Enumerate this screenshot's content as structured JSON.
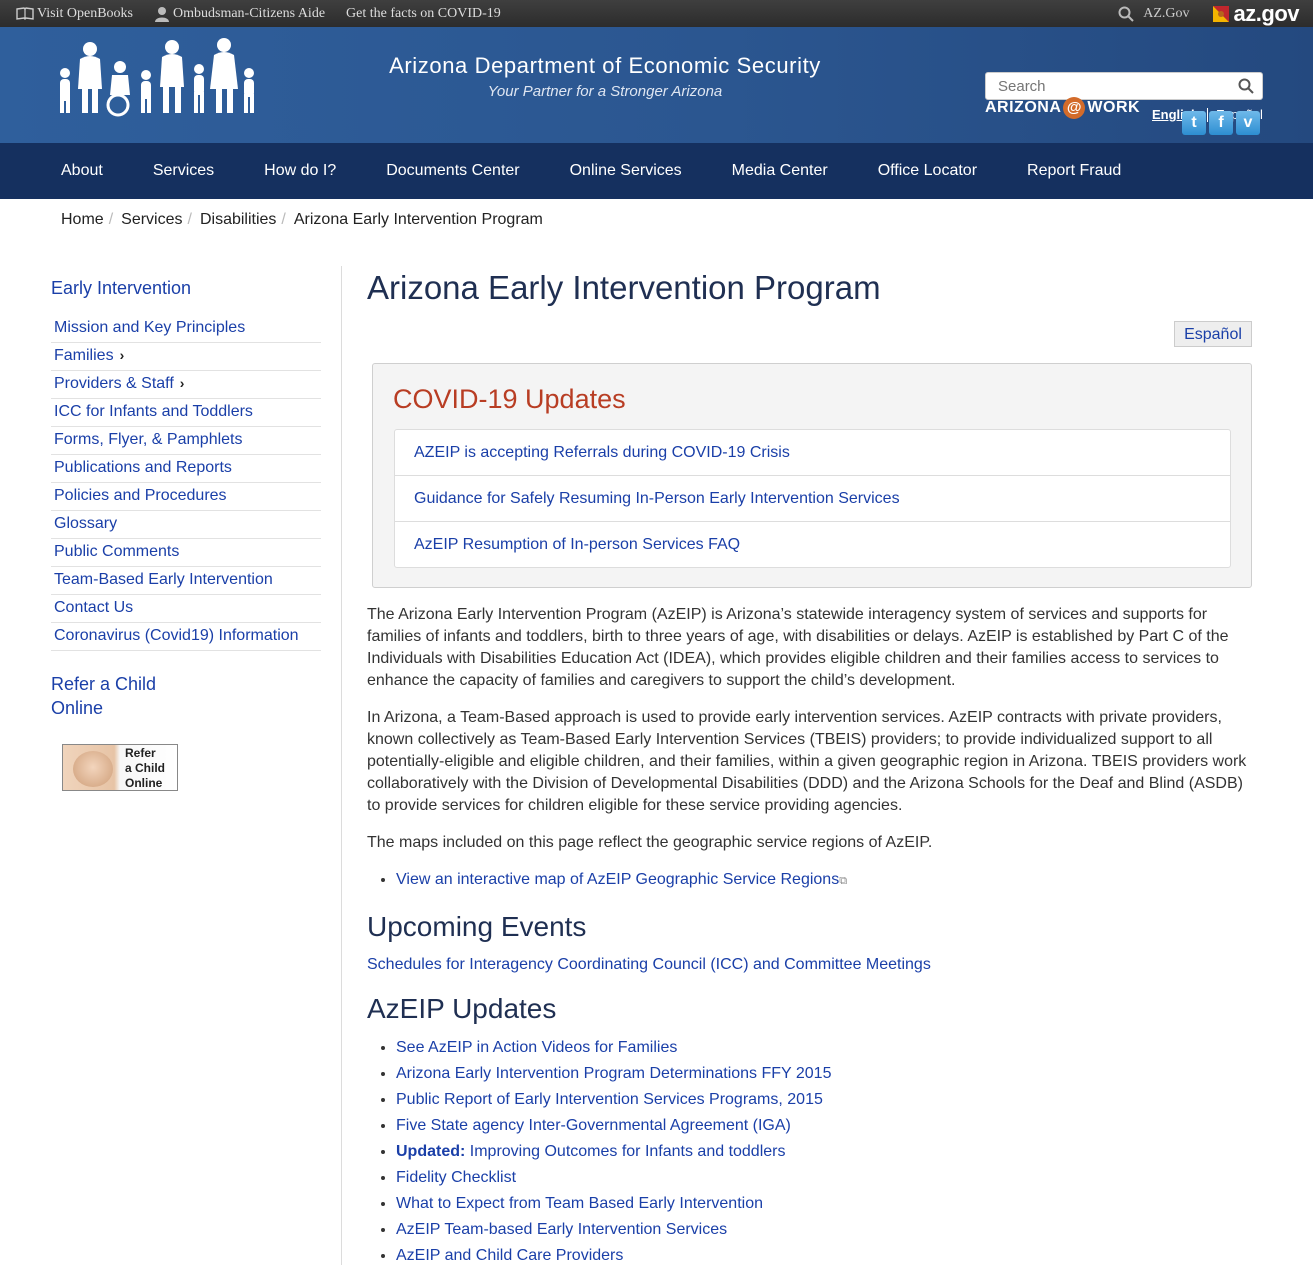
{
  "topbar": {
    "openbooks": "Visit OpenBooks",
    "ombudsman": "Ombudsman-Citizens Aide",
    "covid_facts": "Get the facts on COVID-19",
    "azgov_link": "AZ.Gov",
    "azgov_logo": "az.gov"
  },
  "header": {
    "agency_name": "Arizona Department of Economic Security",
    "tagline": "Your Partner for a Stronger Arizona",
    "search_placeholder": "Search",
    "lang_english": "English",
    "lang_espanol": "Español",
    "azwork_left": "ARIZONA",
    "azwork_at": "@",
    "azwork_right": "WORK",
    "social": [
      "t",
      "f",
      "v"
    ]
  },
  "nav": [
    "About",
    "Services",
    "How do I?",
    "Documents Center",
    "Online Services",
    "Media Center",
    "Office Locator",
    "Report Fraud"
  ],
  "breadcrumb": [
    "Home",
    "Services",
    "Disabilities",
    "Arizona Early Intervention Program"
  ],
  "sidebar": {
    "title": "Early Intervention",
    "items": [
      {
        "label": "Mission and Key Principles",
        "chev": ""
      },
      {
        "label": "Families",
        "chev": "›"
      },
      {
        "label": "Providers & Staff",
        "chev": "›"
      },
      {
        "label": "ICC for Infants and Toddlers",
        "chev": ""
      },
      {
        "label": "Forms, Flyer, & Pamphlets",
        "chev": ""
      },
      {
        "label": "Publications and Reports",
        "chev": ""
      },
      {
        "label": "Policies and Procedures",
        "chev": ""
      },
      {
        "label": "Glossary",
        "chev": ""
      },
      {
        "label": "Public Comments",
        "chev": ""
      },
      {
        "label": "Team-Based Early Intervention",
        "chev": ""
      },
      {
        "label": "Contact Us",
        "chev": ""
      },
      {
        "label": "Coronavirus (Covid19) Information",
        "chev": ""
      }
    ],
    "refer_line1": "Refer a Child",
    "refer_line2": "Online",
    "refer_img_text": [
      "Refer",
      "a Child",
      "Online"
    ]
  },
  "main": {
    "title": "Arizona Early Intervention Program",
    "espanol_button": "Español",
    "covid_title": "COVID-19 Updates",
    "covid_links": [
      "AZEIP is accepting Referrals during COVID-19 Crisis",
      "Guidance for Safely Resuming In-Person Early Intervention Services",
      "AzEIP Resumption of In-person Services FAQ"
    ],
    "para1": "The Arizona Early Intervention Program (AzEIP) is Arizona’s statewide interagency system of services and supports for families of infants and toddlers, birth to three years of age, with disabilities or delays. AzEIP is established by Part C of the Individuals with Disabilities Education Act (IDEA), which provides eligible children and their families access to services to enhance the capacity of families and caregivers to support the child’s development.",
    "para2": "In Arizona, a Team-Based approach is used to provide early intervention services. AzEIP contracts with private providers, known collectively as Team-Based Early Intervention Services (TBEIS) providers; to provide individualized support to all potentially-eligible and eligible children, and their families, within a given geographic region in Arizona. TBEIS providers work collaboratively with the Division of Developmental Disabilities (DDD) and the Arizona Schools for the Deaf and Blind (ASDB) to provide services for children eligible for these service providing agencies.",
    "para3": "The maps included on this page reflect the geographic service regions of AzEIP.",
    "map_link": "View an interactive map of AzEIP Geographic Service Regions",
    "events_title": "Upcoming Events",
    "events_link": "Schedules for Interagency Coordinating Council (ICC) and Committee Meetings",
    "updates_title": "AzEIP Updates",
    "updates": [
      {
        "bold": "",
        "text": "See AzEIP in Action Videos for Families"
      },
      {
        "bold": "",
        "text": "Arizona Early Intervention Program Determinations FFY 2015"
      },
      {
        "bold": "",
        "text": "Public Report of Early Intervention Services Programs, 2015"
      },
      {
        "bold": "",
        "text": "Five State agency Inter-Governmental Agreement (IGA)"
      },
      {
        "bold": "Updated:",
        "text": " Improving Outcomes for Infants and toddlers"
      },
      {
        "bold": "",
        "text": "Fidelity Checklist"
      },
      {
        "bold": "",
        "text": "What to Expect from Team Based Early Intervention"
      },
      {
        "bold": "",
        "text": "AzEIP Team-based Early Intervention Services"
      },
      {
        "bold": "",
        "text": "AzEIP and Child Care Providers"
      }
    ]
  }
}
